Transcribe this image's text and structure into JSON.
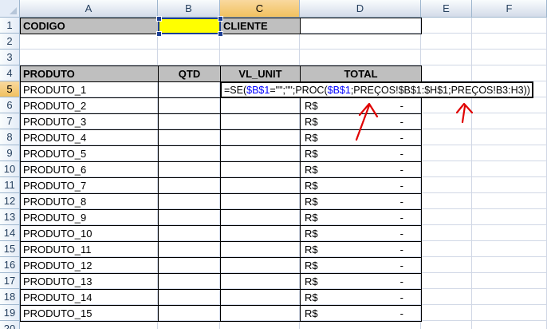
{
  "columns": [
    "A",
    "B",
    "C",
    "D",
    "E",
    "F"
  ],
  "rows": [
    "1",
    "2",
    "3",
    "4",
    "5",
    "6",
    "7",
    "8",
    "9",
    "10",
    "11",
    "12",
    "13",
    "14",
    "15",
    "16",
    "17",
    "18",
    "19",
    "20"
  ],
  "cells": {
    "a1": "CODIGO",
    "c1": "CLIENTE",
    "header": {
      "produto": "PRODUTO",
      "qtd": "QTD",
      "vl_unit": "VL_UNIT",
      "total": "TOTAL"
    },
    "products": [
      "PRODUTO_1",
      "PRODUTO_2",
      "PRODUTO_3",
      "PRODUTO_4",
      "PRODUTO_5",
      "PRODUTO_6",
      "PRODUTO_7",
      "PRODUTO_8",
      "PRODUTO_9",
      "PRODUTO_10",
      "PRODUTO_11",
      "PRODUTO_12",
      "PRODUTO_13",
      "PRODUTO_14",
      "PRODUTO_15"
    ],
    "currency": "R$",
    "dash": "-"
  },
  "formula": {
    "p1": "=SE(",
    "p2": "$B$1",
    "p3": "=\"\";\"\";PROC(",
    "p4": "$B$1",
    "p5": ";PREÇOS!$B$1:$H$1;PREÇOS!B3:H3))"
  },
  "colors": {
    "grid": "#d0d7e5",
    "header_fill": "#bfbfbf",
    "highlight": "#ffff00",
    "selection": "#1c3f94",
    "annotation": "#e00000"
  }
}
